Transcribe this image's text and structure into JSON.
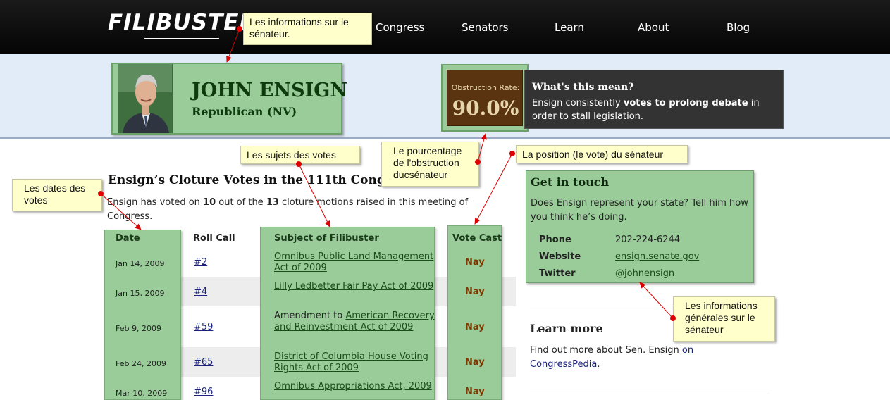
{
  "header": {
    "logo": "FILIBUSTED",
    "nav": [
      {
        "label": "Congress"
      },
      {
        "label": "Senators"
      },
      {
        "label": "Learn"
      },
      {
        "label": "About"
      },
      {
        "label": "Blog"
      }
    ]
  },
  "senator": {
    "name": "JOHN ENSIGN",
    "party": "Republican (NV)",
    "obstruction_label": "Obstruction Rate:",
    "obstruction_rate": "90.0%",
    "meaning_title": "What's this mean?",
    "meaning_pre": "Ensign consistently ",
    "meaning_bold": "votes to prolong debate",
    "meaning_post": " in order to stall legislation."
  },
  "votes": {
    "title": "Ensign’s Cloture Votes in the 111th Congress",
    "intro_pre": "Ensign has voted on ",
    "intro_n1": "10",
    "intro_mid": " out of the ",
    "intro_n2": "13",
    "intro_post": " cloture motions raised in this meeting of Congress.",
    "headers": {
      "date": "Date",
      "roll": "Roll Call",
      "subject": "Subject of Filibuster",
      "vote": "Vote Cast"
    },
    "rows": [
      {
        "date": "Jan 14, 2009",
        "roll": "#2",
        "subject_pre": "",
        "subject_link": "Omnibus Public Land Management Act of 2009",
        "vote": "Nay"
      },
      {
        "date": "Jan 15, 2009",
        "roll": "#4",
        "subject_pre": "",
        "subject_link": "Lilly Ledbetter Fair Pay Act of 2009",
        "vote": "Nay"
      },
      {
        "date": "Feb 9, 2009",
        "roll": "#59",
        "subject_pre": "Amendment to ",
        "subject_link": "American Recovery and Reinvestment Act of 2009",
        "vote": "Nay"
      },
      {
        "date": "Feb 24, 2009",
        "roll": "#65",
        "subject_pre": "",
        "subject_link": "District of Columbia House Voting Rights Act of 2009",
        "vote": "Nay"
      },
      {
        "date": "Mar 10, 2009",
        "roll": "#96",
        "subject_pre": "",
        "subject_link": "Omnibus Appropriations Act, 2009",
        "vote": "Nay"
      }
    ]
  },
  "contact": {
    "title": "Get in touch",
    "desc": "Does Ensign represent your state? Tell him how you think he’s doing.",
    "phone_label": "Phone",
    "phone": "202-224-6244",
    "website_label": "Website",
    "website": "ensign.senate.gov",
    "twitter_label": "Twitter",
    "twitter": "@johnensign"
  },
  "learn": {
    "title": "Learn more",
    "text_pre": "Find out more about Sen. Ensign ",
    "link1": "on",
    "link2": "CongressPedia",
    "text_post": "."
  },
  "callouts": {
    "senator_info": "Les informations sur le sénateur.",
    "subjects": "Les sujets des votes",
    "obstruction": "Le pourcentage de l'obstruction ducsénateur",
    "position": "La position (le vote) du sénateur",
    "dates": "Les dates des votes",
    "general": "Les informations générales sur le sénateur"
  },
  "colors": {
    "green": "#99cc99",
    "brown": "#5a3410",
    "arrow": "#dd0000",
    "callout": "#ffffcc"
  }
}
